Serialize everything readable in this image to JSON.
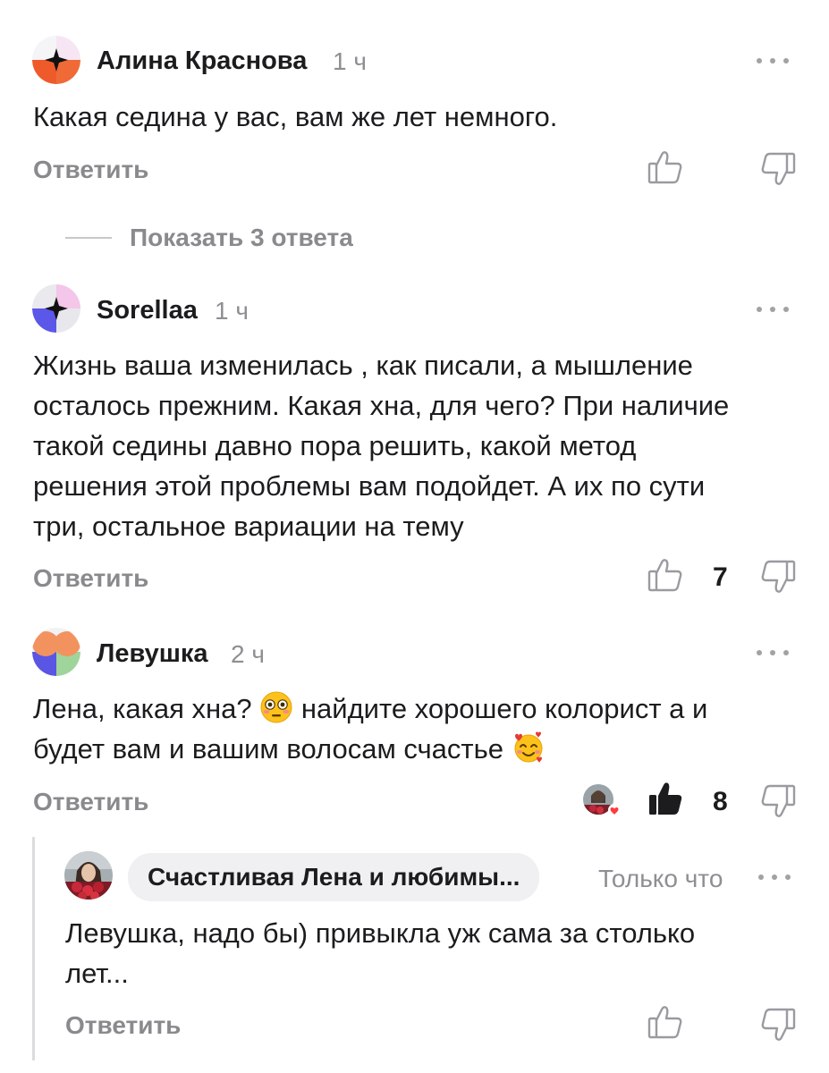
{
  "comments": [
    {
      "author": "Алина Краснова",
      "time": "1 ч",
      "text": "Какая седина у вас, вам же лет немного.",
      "reply_label": "Ответить",
      "show_replies": "Показать 3 ответа"
    },
    {
      "author": "Sorellaa",
      "time": "1 ч",
      "text_lines": [
        "Жизнь ваша изменилась , как писали, а мышление",
        "осталось прежним. Какая хна, для чего? При наличие",
        "такой седины давно пора решить, какой метод",
        "решения этой проблемы вам подойдет. А их по сути",
        "три, остальное вариации на тему"
      ],
      "reply_label": "Ответить",
      "likes": "7"
    },
    {
      "author": "Левушка",
      "time": "2 ч",
      "text_line1_a": "Лена, какая хна?",
      "text_line1_b": "найдите хорошего колорист а и",
      "text_line2": "будет вам и вашим волосам счастье",
      "reply_label": "Ответить",
      "likes": "8"
    }
  ],
  "nested_reply": {
    "author": "Счастливая Лена и любимы...",
    "time": "Только что",
    "text_lines": [
      "Левушка, надо бы) привыкла уж сама за столько",
      "лет..."
    ],
    "reply_label": "Ответить"
  },
  "icons": {
    "like": "thumbs-up-icon",
    "dislike": "thumbs-down-icon",
    "more": "more-dots-icon",
    "emoji_flushed": "flushed-face-emoji",
    "emoji_hearts": "smiling-face-with-hearts-emoji"
  }
}
